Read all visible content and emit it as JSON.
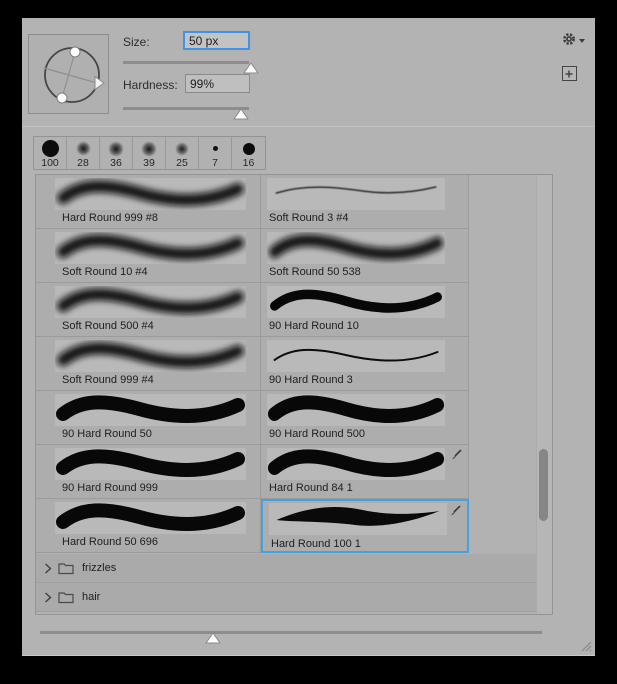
{
  "header": {
    "size_label": "Size:",
    "size_value": "50 px",
    "hardness_label": "Hardness:",
    "hardness_value": "99%"
  },
  "toolbar": {
    "settings_icon": "gear-icon",
    "add_icon": "plus-icon"
  },
  "presets": {
    "items": [
      {
        "label": "100",
        "tip": "hard-large"
      },
      {
        "label": "28",
        "tip": "soft"
      },
      {
        "label": "36",
        "tip": "soft"
      },
      {
        "label": "39",
        "tip": "soft"
      },
      {
        "label": "25",
        "tip": "soft"
      },
      {
        "label": "7",
        "tip": "hard-tiny"
      },
      {
        "label": "16",
        "tip": "hard-small"
      }
    ]
  },
  "list": {
    "rows": [
      {
        "cells": [
          {
            "name": "Hard Round 999 #8",
            "stroke": "soft-thick"
          },
          {
            "name": "Soft Round 3 #4",
            "stroke": "soft-thin"
          }
        ]
      },
      {
        "cells": [
          {
            "name": "Soft Round 10 #4",
            "stroke": "soft-thick"
          },
          {
            "name": "Soft Round 50 538",
            "stroke": "soft-thick"
          }
        ]
      },
      {
        "cells": [
          {
            "name": "Soft Round 500 #4",
            "stroke": "soft-thick"
          },
          {
            "name": "90 Hard Round 10",
            "stroke": "hard-medium"
          }
        ]
      },
      {
        "cells": [
          {
            "name": "Soft Round 999 #4",
            "stroke": "soft-thick"
          },
          {
            "name": "90 Hard Round 3",
            "stroke": "hard-thin"
          }
        ]
      },
      {
        "cells": [
          {
            "name": "90 Hard Round 50",
            "stroke": "hard-thick"
          },
          {
            "name": "90 Hard Round 500",
            "stroke": "hard-thick"
          }
        ]
      },
      {
        "cells": [
          {
            "name": "90 Hard Round 999",
            "stroke": "hard-thick"
          },
          {
            "name": "Hard Round 84 1",
            "stroke": "hard-thick",
            "badge": "brush-icon"
          }
        ]
      },
      {
        "cells": [
          {
            "name": "Hard Round 50 696",
            "stroke": "hard-thick"
          },
          {
            "name": "Hard Round 100 1",
            "stroke": "taper",
            "badge": "brush-icon",
            "selected": true
          }
        ]
      }
    ],
    "selected_brush": "Hard Round 100 1",
    "folders": [
      {
        "label": "frizzles"
      },
      {
        "label": "hair"
      }
    ]
  },
  "colors": {
    "panel_bg": "#b3b3b3",
    "selection_border": "#45a2e1",
    "focus_border": "#3f94e8",
    "scroll_thumb": "#868686"
  }
}
